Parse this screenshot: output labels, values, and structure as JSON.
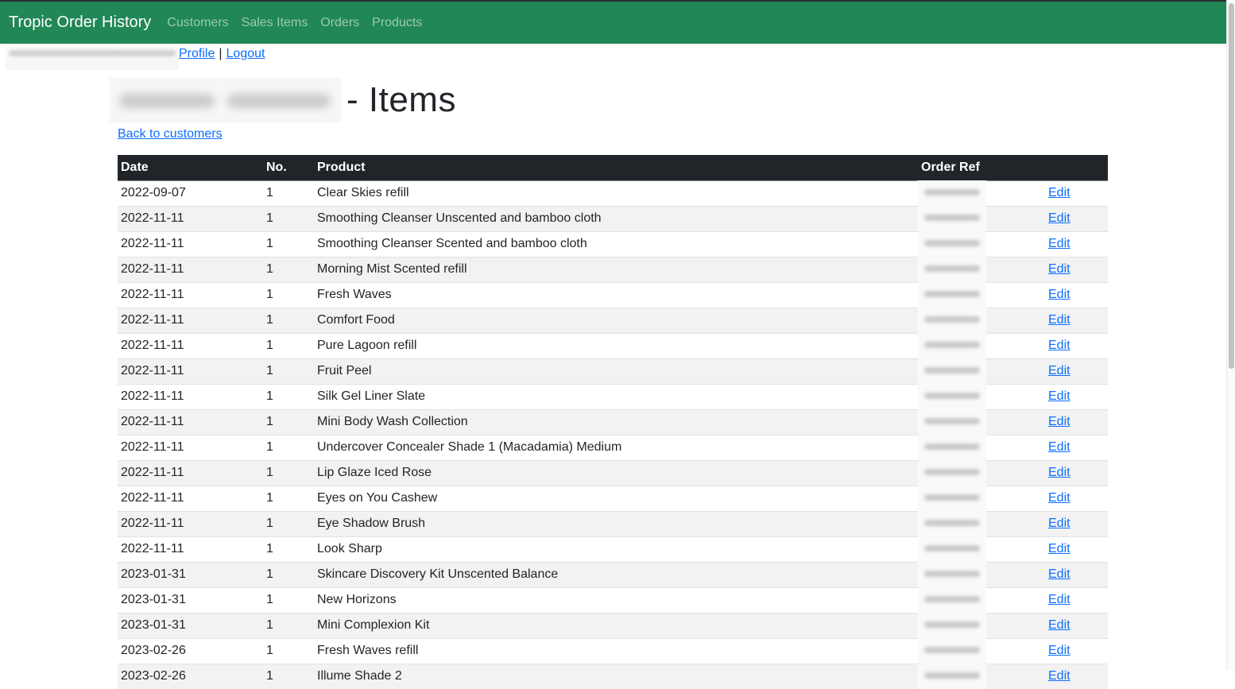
{
  "navbar": {
    "brand": "Tropic Order History",
    "links": [
      "Customers",
      "Sales Items",
      "Orders",
      "Products"
    ],
    "color": "#218756"
  },
  "userbar": {
    "email": "[redacted]",
    "profile_label": "Profile",
    "separator": "|",
    "logout_label": "Logout"
  },
  "page": {
    "customer_name": "[redacted]",
    "title_suffix": "- Items",
    "back_link": "Back to customers"
  },
  "table": {
    "columns": [
      "Date",
      "No.",
      "Product",
      "Order Ref",
      ""
    ],
    "edit_label": "Edit",
    "rows": [
      {
        "date": "2022-09-07",
        "no": "1",
        "product": "Clear Skies refill",
        "order_ref": "[redacted]"
      },
      {
        "date": "2022-11-11",
        "no": "1",
        "product": "Smoothing Cleanser Unscented and bamboo cloth",
        "order_ref": "[redacted]"
      },
      {
        "date": "2022-11-11",
        "no": "1",
        "product": "Smoothing Cleanser Scented and bamboo cloth",
        "order_ref": "[redacted]"
      },
      {
        "date": "2022-11-11",
        "no": "1",
        "product": "Morning Mist Scented refill",
        "order_ref": "[redacted]"
      },
      {
        "date": "2022-11-11",
        "no": "1",
        "product": "Fresh Waves",
        "order_ref": "[redacted]"
      },
      {
        "date": "2022-11-11",
        "no": "1",
        "product": "Comfort Food",
        "order_ref": "[redacted]"
      },
      {
        "date": "2022-11-11",
        "no": "1",
        "product": "Pure Lagoon refill",
        "order_ref": "[redacted]"
      },
      {
        "date": "2022-11-11",
        "no": "1",
        "product": "Fruit Peel",
        "order_ref": "[redacted]"
      },
      {
        "date": "2022-11-11",
        "no": "1",
        "product": "Silk Gel Liner Slate",
        "order_ref": "[redacted]"
      },
      {
        "date": "2022-11-11",
        "no": "1",
        "product": "Mini Body Wash Collection",
        "order_ref": "[redacted]"
      },
      {
        "date": "2022-11-11",
        "no": "1",
        "product": "Undercover Concealer Shade 1 (Macadamia) Medium",
        "order_ref": "[redacted]"
      },
      {
        "date": "2022-11-11",
        "no": "1",
        "product": "Lip Glaze Iced Rose",
        "order_ref": "[redacted]"
      },
      {
        "date": "2022-11-11",
        "no": "1",
        "product": "Eyes on You Cashew",
        "order_ref": "[redacted]"
      },
      {
        "date": "2022-11-11",
        "no": "1",
        "product": "Eye Shadow Brush",
        "order_ref": "[redacted]"
      },
      {
        "date": "2022-11-11",
        "no": "1",
        "product": "Look Sharp",
        "order_ref": "[redacted]"
      },
      {
        "date": "2023-01-31",
        "no": "1",
        "product": "Skincare Discovery Kit Unscented Balance",
        "order_ref": "[redacted]"
      },
      {
        "date": "2023-01-31",
        "no": "1",
        "product": "New Horizons",
        "order_ref": "[redacted]"
      },
      {
        "date": "2023-01-31",
        "no": "1",
        "product": "Mini Complexion Kit",
        "order_ref": "[redacted]"
      },
      {
        "date": "2023-02-26",
        "no": "1",
        "product": "Fresh Waves refill",
        "order_ref": "[redacted]"
      },
      {
        "date": "2023-02-26",
        "no": "1",
        "product": "Illume Shade 2",
        "order_ref": "[redacted]"
      }
    ]
  }
}
